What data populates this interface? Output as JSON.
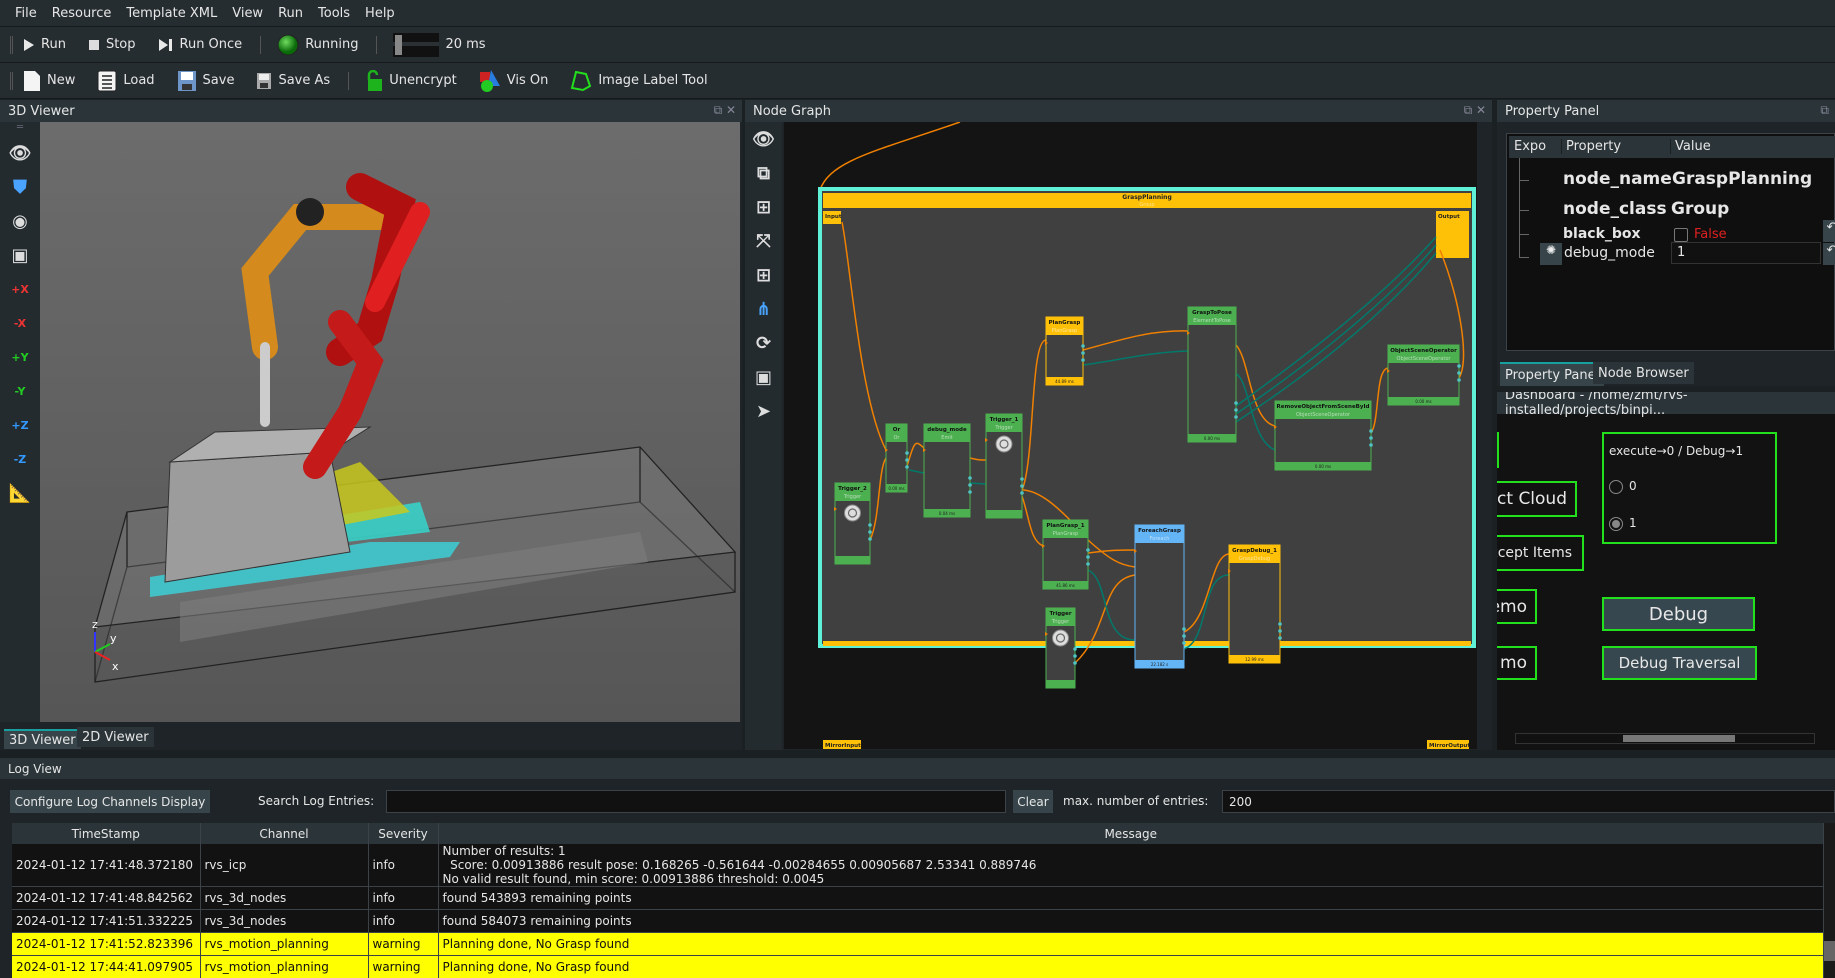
{
  "menu": [
    "File",
    "Resource",
    "Template XML",
    "View",
    "Run",
    "Tools",
    "Help"
  ],
  "toolbar1": {
    "run": "Run",
    "stop": "Stop",
    "run_once": "Run Once",
    "status": "Running",
    "interval": "20 ms"
  },
  "toolbar2": {
    "new": "New",
    "load": "Load",
    "save": "Save",
    "save_as": "Save As",
    "unencrypt": "Unencrypt",
    "vis_on": "Vis On",
    "image_label_tool": "Image Label Tool"
  },
  "viewer3d": {
    "title": "3D Viewer",
    "tabs": [
      "3D Viewer",
      "2D Viewer"
    ],
    "icons": [
      "eye-icon",
      "shield-icon",
      "target-icon",
      "camera-icon",
      "+X",
      "-X",
      "+Y",
      "-Y",
      "+Z",
      "-Z",
      "ruler-icon"
    ],
    "axes": {
      "x": "x",
      "y": "y",
      "z": "z"
    }
  },
  "node_graph": {
    "title": "Node Graph",
    "group": {
      "name": "GraspPlanning",
      "class": "Group"
    },
    "ports": {
      "input": "Input",
      "output": "Output",
      "mirror_input": "MirrorInput",
      "mirror_output": "MirrorOutput"
    },
    "nodes": [
      {
        "name": "Trigger_2",
        "class": "Trigger",
        "timing": "",
        "kind": "trigger"
      },
      {
        "name": "Or",
        "class": "Or",
        "timing": "0.00 ms",
        "kind": "green"
      },
      {
        "name": "debug_mode",
        "class": "Emit",
        "timing": "0.04 ms",
        "kind": "green"
      },
      {
        "name": "Trigger_1",
        "class": "Trigger",
        "timing": "",
        "kind": "trigger"
      },
      {
        "name": "PlanGrasp",
        "class": "PlanGrasp",
        "timing": "44.89 ms",
        "kind": "yellow"
      },
      {
        "name": "GraspToPose",
        "class": "ElementToPose",
        "timing": "0.00 ms",
        "kind": "green"
      },
      {
        "name": "RemoveObjectFromSceneById",
        "class": "ObjectSceneOperator",
        "timing": "0.00 ms",
        "kind": "green"
      },
      {
        "name": "ObjectSceneOperator",
        "class": "ObjectSceneOperator",
        "timing": "0.00 ms",
        "kind": "green"
      },
      {
        "name": "PlanGrasp_1",
        "class": "PlanGrasp",
        "timing": "41.86 ms",
        "kind": "green"
      },
      {
        "name": "Trigger",
        "class": "Trigger",
        "timing": "",
        "kind": "trigger"
      },
      {
        "name": "ForeachGrasp",
        "class": "Foreach",
        "timing": "22.182 s",
        "kind": "blue"
      },
      {
        "name": "GraspDebug_1",
        "class": "GraspDebug",
        "timing": "12.99 ms",
        "kind": "yellow"
      }
    ]
  },
  "property_panel": {
    "title": "Property Panel",
    "columns": [
      "Expo",
      "Property",
      "Value"
    ],
    "rows": [
      {
        "property": "node_name",
        "value": "GraspPlanning"
      },
      {
        "property": "node_class",
        "value": "Group"
      },
      {
        "property": "black_box",
        "value": "False"
      },
      {
        "property": "debug_mode",
        "value": "1"
      }
    ],
    "tabs": [
      "Property Panel",
      "Node Browser"
    ]
  },
  "dashboard": {
    "title": "Dashboard - /home/zmt/rvs-installed/projects/binpi...",
    "buttons_left": [
      "ect Cloud",
      "Except Items",
      "emo",
      "mo"
    ],
    "radio_group": {
      "label": "execute→0 / Debug→1",
      "options": [
        "0",
        "1"
      ],
      "selected": "1"
    },
    "debug": "Debug",
    "debug_traversal": "Debug Traversal"
  },
  "log": {
    "title": "Log View",
    "configure": "Configure Log Channels Display",
    "search_label": "Search Log Entries:",
    "search_value": "",
    "clear": "Clear",
    "max_label": "max. number of entries:",
    "max_value": "200",
    "columns": [
      "TimeStamp",
      "Channel",
      "Severity",
      "Message"
    ],
    "rows": [
      {
        "time": "2024-01-12 17:41:48.372180",
        "channel": "rvs_icp",
        "severity": "info",
        "message": [
          "Number of results: 1",
          "  Score: 0.00913886 result pose: 0.168265 -0.561644 -0.00284655 0.00905687 2.53341 0.889746",
          "No valid result found, min score: 0.00913886 threshold: 0.0045"
        ]
      },
      {
        "time": "2024-01-12 17:41:48.842562",
        "channel": "rvs_3d_nodes",
        "severity": "info",
        "message": [
          "found 543893 remaining points"
        ]
      },
      {
        "time": "2024-01-12 17:41:51.332225",
        "channel": "rvs_3d_nodes",
        "severity": "info",
        "message": [
          "found 584073 remaining points"
        ]
      },
      {
        "time": "2024-01-12 17:41:52.823396",
        "channel": "rvs_motion_planning",
        "severity": "warning",
        "message": [
          "Planning done, No Grasp found"
        ]
      },
      {
        "time": "2024-01-12 17:44:41.097905",
        "channel": "rvs_motion_planning",
        "severity": "warning",
        "message": [
          "Planning done, No Grasp found"
        ]
      }
    ]
  },
  "colors": {
    "accent_green": "#22e01c",
    "warning_row": "#ffff00",
    "group_border": "#5ff0d8",
    "group_header": "#ffc107",
    "node_green": "#4caf50",
    "node_blue": "#64b5f6",
    "edge_exec": "#f08000",
    "edge_data": "#00796b",
    "false_text": "#e02020"
  }
}
